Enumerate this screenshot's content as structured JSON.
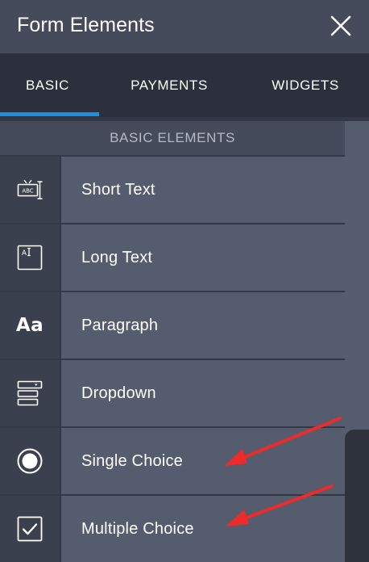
{
  "header": {
    "title": "Form Elements",
    "close_icon": "close-icon"
  },
  "tabs": [
    {
      "label": "BASIC",
      "active": true
    },
    {
      "label": "PAYMENTS",
      "active": false
    },
    {
      "label": "WIDGETS",
      "active": false
    }
  ],
  "section": {
    "title": "BASIC ELEMENTS"
  },
  "elements": [
    {
      "label": "Short Text",
      "icon": "short-text-icon",
      "icon_text": "ABC"
    },
    {
      "label": "Long Text",
      "icon": "long-text-icon",
      "icon_text": "A"
    },
    {
      "label": "Paragraph",
      "icon": "paragraph-icon",
      "icon_text": "Aa"
    },
    {
      "label": "Dropdown",
      "icon": "dropdown-icon"
    },
    {
      "label": "Single Choice",
      "icon": "radio-button-icon"
    },
    {
      "label": "Multiple Choice",
      "icon": "checkbox-icon"
    }
  ],
  "colors": {
    "header_bg": "#454b5a",
    "tabs_bg": "#2b303c",
    "active_tab_underline": "#1b8fe1",
    "icon_cell_bg": "#3a404e",
    "label_cell_bg": "#545c6d",
    "annotation_arrow": "#ee2a2a"
  },
  "annotations": [
    {
      "type": "arrow",
      "points_to": "Single Choice"
    },
    {
      "type": "arrow",
      "points_to": "Multiple Choice"
    }
  ]
}
